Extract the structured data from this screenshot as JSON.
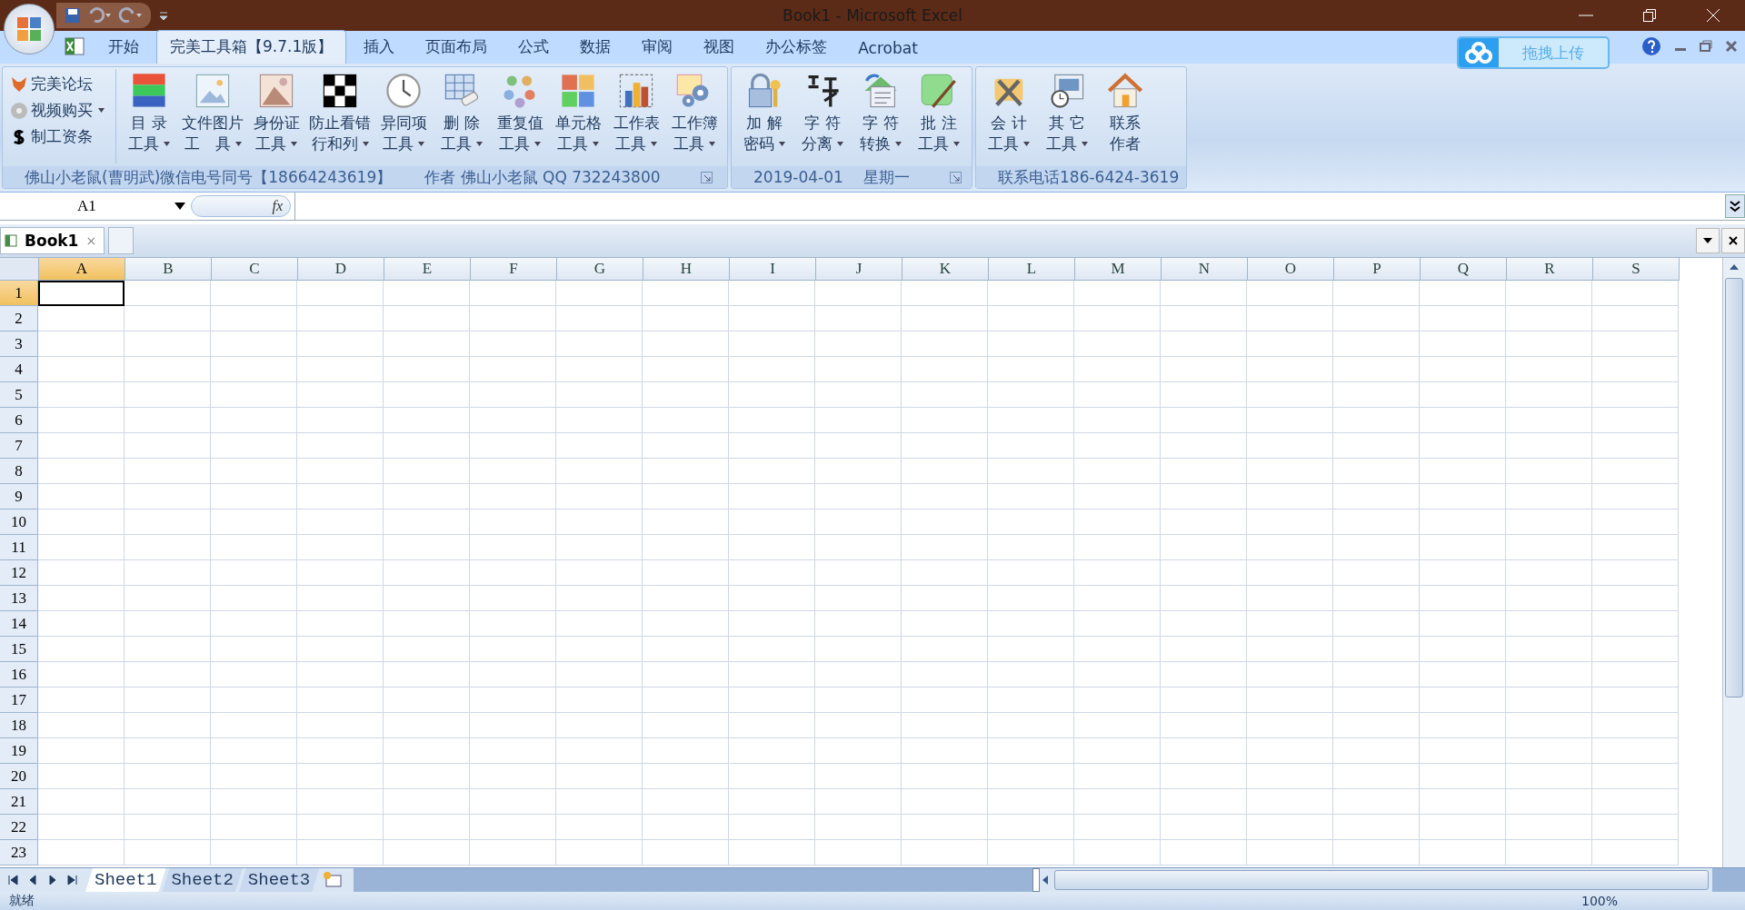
{
  "window": {
    "title": "Book1 - Microsoft Excel"
  },
  "ribbon_tabs": [
    {
      "label": "开始",
      "selected": false
    },
    {
      "label": "完美工具箱【9.7.1版】",
      "selected": true
    },
    {
      "label": "插入",
      "selected": false
    },
    {
      "label": "页面布局",
      "selected": false
    },
    {
      "label": "公式",
      "selected": false
    },
    {
      "label": "数据",
      "selected": false
    },
    {
      "label": "审阅",
      "selected": false
    },
    {
      "label": "视图",
      "selected": false
    },
    {
      "label": "办公标签",
      "selected": false
    },
    {
      "label": "Acrobat",
      "selected": false
    }
  ],
  "upload_button": "拖拽上传",
  "quick_links": [
    {
      "label": "完美论坛",
      "dropdown": false
    },
    {
      "label": "视频购买",
      "dropdown": true
    },
    {
      "label": "制工资条",
      "dropdown": false
    }
  ],
  "groups": [
    {
      "footer": [
        "佛山小老鼠(曹明武)微信电号同号【18664243619】",
        "作者 佛山小老鼠 QQ 732243800"
      ],
      "launcher": true,
      "buttons": [
        {
          "line1": "目 录",
          "line2": "工具",
          "dropdown": true
        },
        {
          "line1": "文件图片",
          "line2": "工　具",
          "dropdown": true
        },
        {
          "line1": "身份证",
          "line2": "工具",
          "dropdown": true
        },
        {
          "line1": "防止看错",
          "line2": "行和列",
          "dropdown": true
        },
        {
          "line1": "异同项",
          "line2": "工具",
          "dropdown": true
        },
        {
          "line1": "删 除",
          "line2": "工具",
          "dropdown": true
        },
        {
          "line1": "重复值",
          "line2": "工具",
          "dropdown": true
        },
        {
          "line1": "单元格",
          "line2": "工具",
          "dropdown": true
        },
        {
          "line1": "工作表",
          "line2": "工具",
          "dropdown": true
        },
        {
          "line1": "工作簿",
          "line2": "工具",
          "dropdown": true
        }
      ]
    },
    {
      "footer": [
        "2019-04-01　 星期一"
      ],
      "launcher": true,
      "buttons": [
        {
          "line1": "加 解",
          "line2": "密码",
          "dropdown": true
        },
        {
          "line1": "字 符",
          "line2": "分离",
          "dropdown": true
        },
        {
          "line1": "字 符",
          "line2": "转换",
          "dropdown": true
        },
        {
          "line1": "批 注",
          "line2": "工具",
          "dropdown": true
        }
      ]
    },
    {
      "footer": [
        "联系电话186-6424-3619"
      ],
      "launcher": false,
      "buttons": [
        {
          "line1": "会 计",
          "line2": "工具",
          "dropdown": true
        },
        {
          "line1": "其 它",
          "line2": "工具",
          "dropdown": true
        },
        {
          "line1": "联系",
          "line2": "作者",
          "dropdown": false
        }
      ]
    }
  ],
  "name_box": "A1",
  "formula_label": "fx",
  "workbook_tabs": [
    {
      "label": "Book1",
      "close": "×",
      "selected": true
    }
  ],
  "columns": [
    {
      "label": "A",
      "selected": true
    },
    {
      "label": "B",
      "selected": false
    },
    {
      "label": "C",
      "selected": false
    },
    {
      "label": "D",
      "selected": false
    },
    {
      "label": "E",
      "selected": false
    },
    {
      "label": "F",
      "selected": false
    },
    {
      "label": "G",
      "selected": false
    },
    {
      "label": "H",
      "selected": false
    },
    {
      "label": "I",
      "selected": false
    },
    {
      "label": "J",
      "selected": false
    },
    {
      "label": "K",
      "selected": false
    },
    {
      "label": "L",
      "selected": false
    },
    {
      "label": "M",
      "selected": false
    },
    {
      "label": "N",
      "selected": false
    },
    {
      "label": "O",
      "selected": false
    },
    {
      "label": "P",
      "selected": false
    },
    {
      "label": "Q",
      "selected": false
    },
    {
      "label": "R",
      "selected": false
    },
    {
      "label": "S",
      "selected": false
    }
  ],
  "rows": [
    {
      "label": "1",
      "selected": true
    },
    {
      "label": "2",
      "selected": false
    },
    {
      "label": "3",
      "selected": false
    },
    {
      "label": "4",
      "selected": false
    },
    {
      "label": "5",
      "selected": false
    },
    {
      "label": "6",
      "selected": false
    },
    {
      "label": "7",
      "selected": false
    },
    {
      "label": "8",
      "selected": false
    },
    {
      "label": "9",
      "selected": false
    },
    {
      "label": "10",
      "selected": false
    },
    {
      "label": "11",
      "selected": false
    },
    {
      "label": "12",
      "selected": false
    },
    {
      "label": "13",
      "selected": false
    },
    {
      "label": "14",
      "selected": false
    },
    {
      "label": "15",
      "selected": false
    },
    {
      "label": "16",
      "selected": false
    },
    {
      "label": "17",
      "selected": false
    },
    {
      "label": "18",
      "selected": false
    },
    {
      "label": "19",
      "selected": false
    },
    {
      "label": "20",
      "selected": false
    },
    {
      "label": "21",
      "selected": false
    },
    {
      "label": "22",
      "selected": false
    },
    {
      "label": "23",
      "selected": false
    }
  ],
  "sheet_tabs": [
    {
      "label": "Sheet1",
      "selected": true
    },
    {
      "label": "Sheet2",
      "selected": false
    },
    {
      "label": "Sheet3",
      "selected": false
    }
  ],
  "status_bar": {
    "text": "就绪",
    "zoom": "100%"
  }
}
